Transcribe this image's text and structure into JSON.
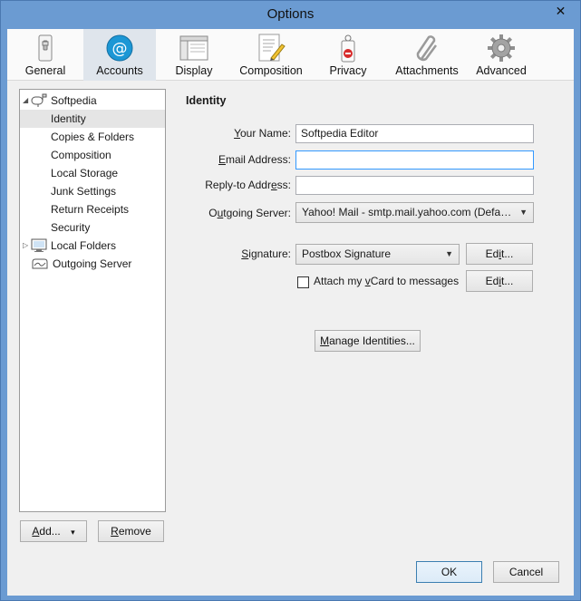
{
  "window": {
    "title": "Options"
  },
  "toolbar": {
    "items": [
      {
        "label": "General"
      },
      {
        "label": "Accounts"
      },
      {
        "label": "Display"
      },
      {
        "label": "Composition"
      },
      {
        "label": "Privacy"
      },
      {
        "label": "Attachments"
      },
      {
        "label": "Advanced"
      }
    ],
    "selected": "Accounts",
    "accent": "#1c97d5"
  },
  "tree": {
    "items": [
      {
        "label": "Softpedia"
      },
      {
        "label": "Identity"
      },
      {
        "label": "Copies & Folders"
      },
      {
        "label": "Composition"
      },
      {
        "label": "Local Storage"
      },
      {
        "label": "Junk Settings"
      },
      {
        "label": "Return Receipts"
      },
      {
        "label": "Security"
      },
      {
        "label": "Local Folders"
      },
      {
        "label": "Outgoing Server"
      }
    ],
    "selected": "Identity"
  },
  "panel": {
    "heading": "Identity",
    "your_name": {
      "label_pre": "",
      "label_u": "Y",
      "label_post": "our Name:",
      "value": "Softpedia Editor"
    },
    "email": {
      "label_pre": "",
      "label_u": "E",
      "label_post": "mail Address:",
      "value": ""
    },
    "reply_to": {
      "label_pre": "Reply-to Addr",
      "label_u": "e",
      "label_post": "ss:",
      "value": ""
    },
    "outgoing": {
      "label_pre": "O",
      "label_u": "u",
      "label_post": "tgoing Server:",
      "value": "Yahoo! Mail - smtp.mail.yahoo.com (Defa…"
    },
    "signature": {
      "label_pre": "",
      "label_u": "S",
      "label_post": "ignature:",
      "value": "Postbox Signature",
      "edit_pre": "Ed",
      "edit_u": "i",
      "edit_post": "t..."
    },
    "vcard": {
      "label_pre": "Attach my ",
      "label_u": "v",
      "label_post": "Card to messages",
      "checked": false,
      "edit_pre": "Ed",
      "edit_u": "i",
      "edit_post": "t..."
    },
    "manage_button": {
      "pre": "",
      "u": "M",
      "post": "anage Identities..."
    }
  },
  "buttons": {
    "add": {
      "pre": "",
      "u": "A",
      "post": "dd...",
      "arrow": "▾"
    },
    "remove": {
      "pre": "",
      "u": "R",
      "post": "emove"
    },
    "ok": "OK",
    "cancel": "Cancel"
  }
}
